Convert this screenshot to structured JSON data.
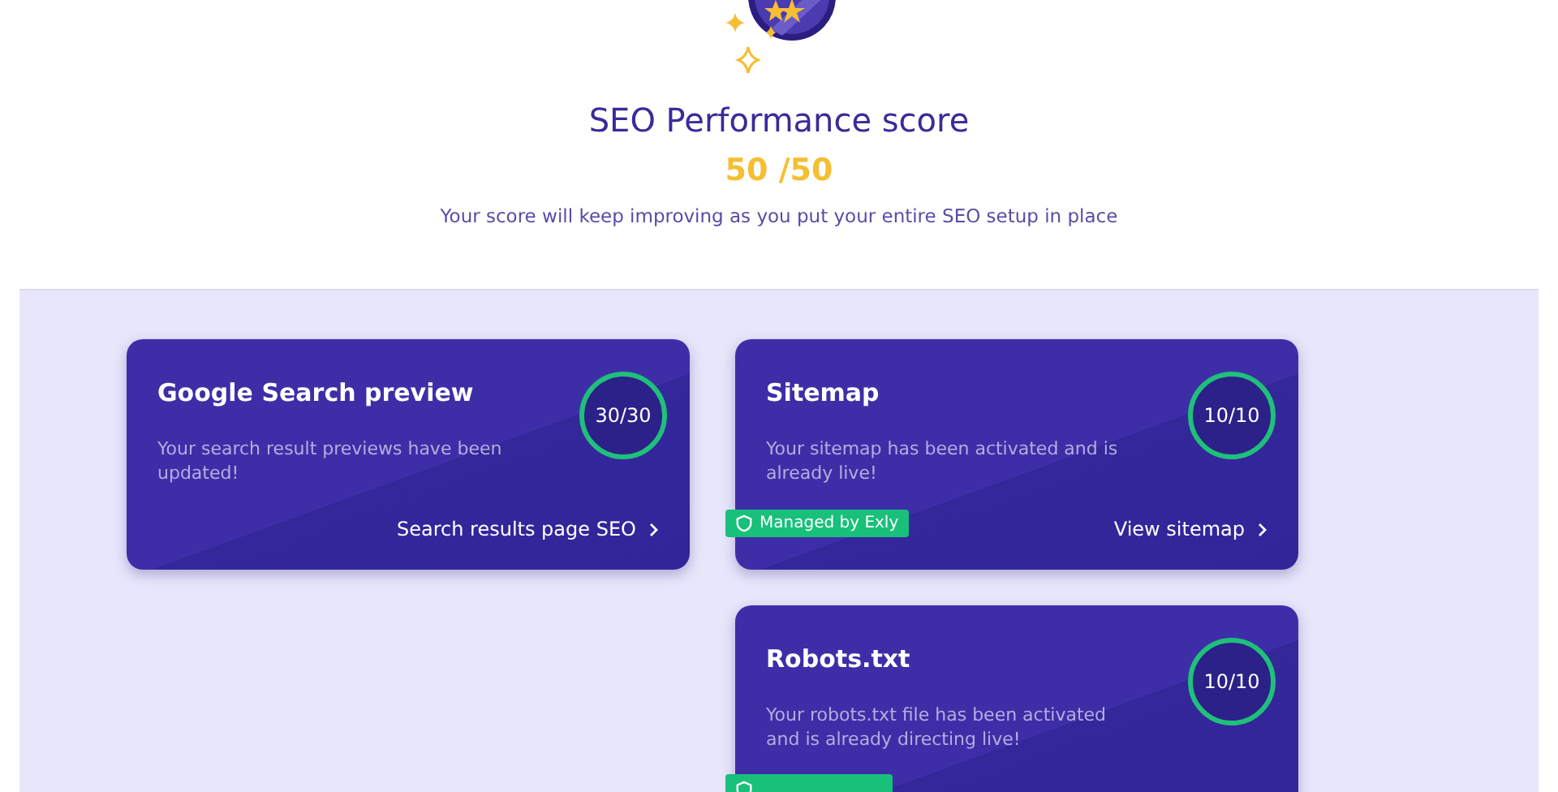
{
  "header": {
    "title": "SEO Performance score",
    "score": "50 /50",
    "subtitle": "Your score will keep improving as you put your entire SEO setup in place"
  },
  "cards": [
    {
      "title": "Google Search preview",
      "description": "Your search result previews have been updated!",
      "score": "30/30",
      "link": "Search results page SEO",
      "managed": false
    },
    {
      "title": "Sitemap",
      "description": "Your sitemap has been activated and is already live!",
      "score": "10/10",
      "link": "View sitemap",
      "managed": true,
      "badge": "Managed by Exly"
    },
    {
      "title": "Robots.txt",
      "description": "Your robots.txt file has been activated and is already directing live!",
      "score": "10/10",
      "managed": true
    }
  ]
}
